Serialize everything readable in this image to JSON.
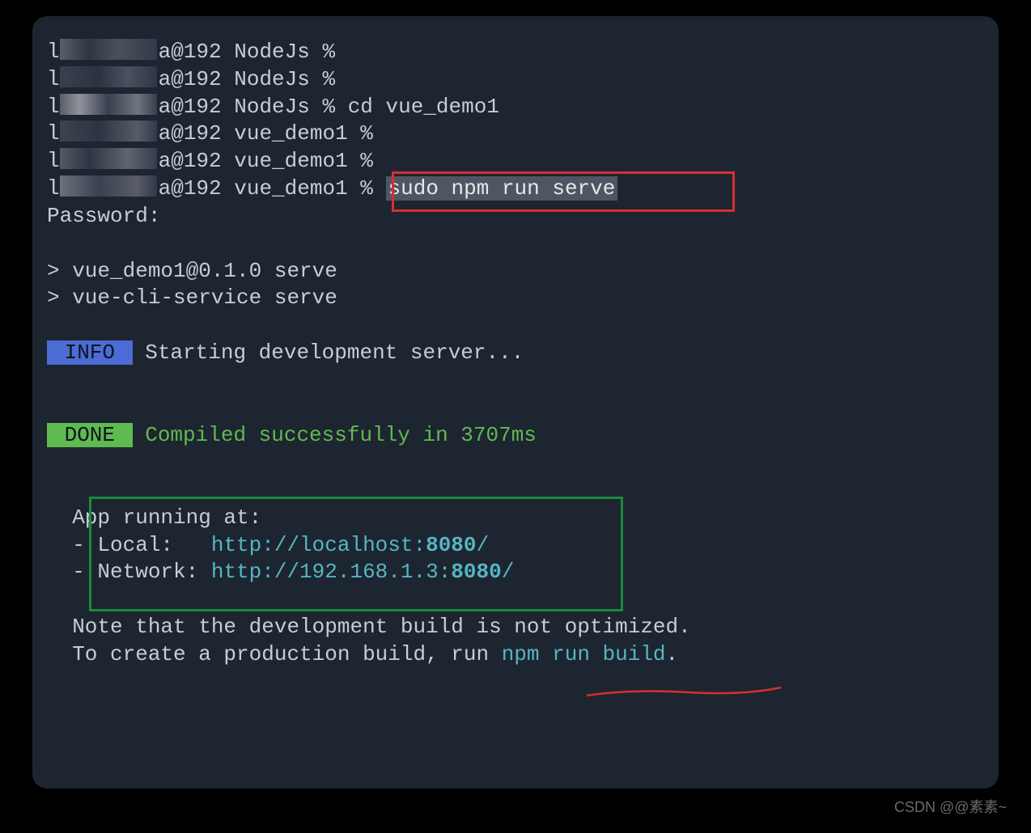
{
  "prompts": [
    {
      "host": "@192",
      "dir": "NodeJs",
      "sep": "%",
      "cmd": ""
    },
    {
      "host": "@192",
      "dir": "NodeJs",
      "sep": "%",
      "cmd": ""
    },
    {
      "host": "@192",
      "dir": "NodeJs",
      "sep": "%",
      "cmd": "cd vue_demo1"
    },
    {
      "host": "@192",
      "dir": "vue_demo1",
      "sep": "%",
      "cmd": ""
    },
    {
      "host": "@192",
      "dir": "vue_demo1",
      "sep": "%",
      "cmd": ""
    },
    {
      "host": "@192",
      "dir": "vue_demo1",
      "sep": "%",
      "cmd": "sudo npm run serve",
      "highlighted": true
    }
  ],
  "password_prompt": "Password:",
  "npm_output": {
    "line1": "> vue_demo1@0.1.0 serve",
    "line2": "> vue-cli-service serve"
  },
  "info": {
    "badge": " INFO ",
    "text": " Starting development server..."
  },
  "done": {
    "badge": " DONE ",
    "text": " Compiled successfully in 3707ms"
  },
  "app_running": {
    "header": "  App running at:",
    "local_label": "  - Local:   ",
    "local_url_prefix": "http://localhost:",
    "local_port": "8080",
    "local_suffix": "/",
    "network_label": "  - Network: ",
    "network_url_prefix": "http://192.168.1.3:",
    "network_port": "8080",
    "network_suffix": "/"
  },
  "note": {
    "line1": "  Note that the development build is not optimized.",
    "line2_prefix": "  To create a production build, run ",
    "line2_cmd": "npm run build",
    "line2_suffix": "."
  },
  "watermark": "CSDN @@素素~"
}
